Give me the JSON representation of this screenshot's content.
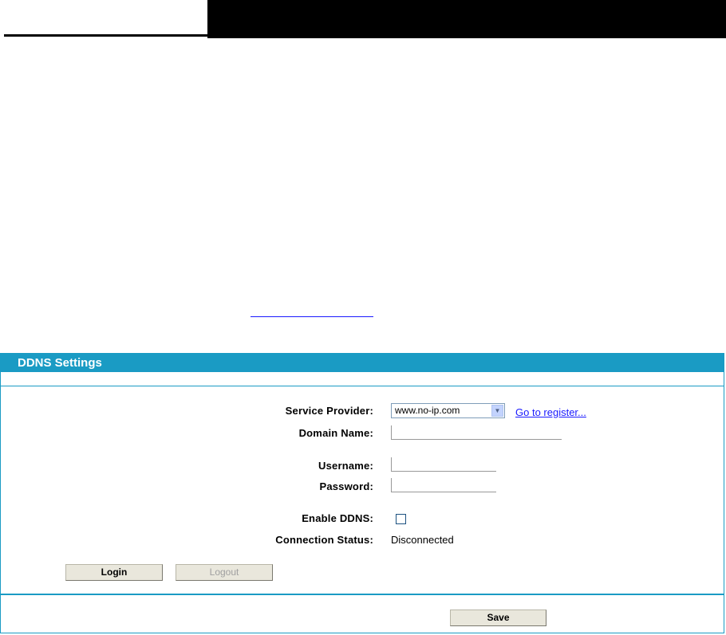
{
  "panel": {
    "title": "DDNS Settings"
  },
  "fields": {
    "service_provider_label": "Service Provider:",
    "service_provider_value": "www.no-ip.com",
    "register_link": "Go to register...",
    "domain_name_label": "Domain Name:",
    "domain_name_value": "",
    "username_label": "Username:",
    "username_value": "",
    "password_label": "Password:",
    "password_value": "",
    "enable_ddns_label": "Enable DDNS:",
    "enable_ddns_checked": false,
    "connection_status_label": "Connection Status:",
    "connection_status_value": "Disconnected"
  },
  "buttons": {
    "login": "Login",
    "logout": "Logout",
    "save": "Save"
  },
  "colors": {
    "accent": "#1a9bc4",
    "link": "#1a1aff"
  },
  "icons": {
    "select_arrow": "chevron-down-icon"
  }
}
